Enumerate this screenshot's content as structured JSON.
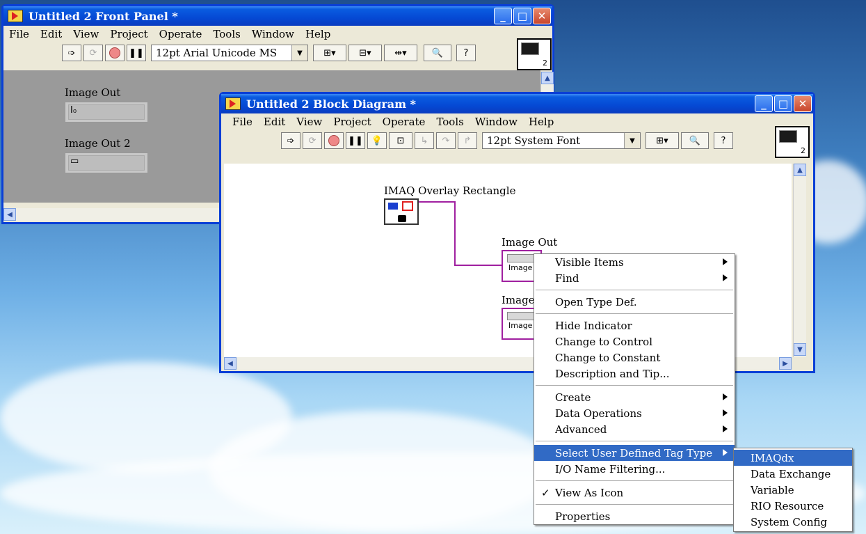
{
  "front_panel": {
    "title": "Untitled 2 Front Panel *",
    "menus": [
      "File",
      "Edit",
      "View",
      "Project",
      "Operate",
      "Tools",
      "Window",
      "Help"
    ],
    "font": "12pt Arial Unicode MS",
    "controls": [
      {
        "label": "Image Out",
        "value": "I₀"
      },
      {
        "label": "Image Out 2",
        "value": ""
      }
    ]
  },
  "block_diagram": {
    "title": "Untitled 2 Block Diagram *",
    "menus": [
      "File",
      "Edit",
      "View",
      "Project",
      "Operate",
      "Tools",
      "Window",
      "Help"
    ],
    "font": "12pt System Font",
    "node_label": "IMAQ Overlay Rectangle",
    "terminals": [
      {
        "label": "Image Out",
        "text": "Image"
      },
      {
        "label": "Image",
        "text": "Image"
      }
    ]
  },
  "icon_number": "2",
  "context_menu": {
    "items": [
      {
        "label": "Visible Items",
        "sub": true
      },
      {
        "label": "Find",
        "sub": true
      },
      {
        "sep": true
      },
      {
        "label": "Open Type Def."
      },
      {
        "sep": true
      },
      {
        "label": "Hide Indicator"
      },
      {
        "label": "Change to Control"
      },
      {
        "label": "Change to Constant"
      },
      {
        "label": "Description and Tip..."
      },
      {
        "sep": true
      },
      {
        "label": "Create",
        "sub": true
      },
      {
        "label": "Data Operations",
        "sub": true
      },
      {
        "label": "Advanced",
        "sub": true
      },
      {
        "sep": true
      },
      {
        "label": "Select User Defined Tag Type",
        "sub": true,
        "selected": true
      },
      {
        "label": "I/O Name Filtering..."
      },
      {
        "sep": true
      },
      {
        "label": "View As Icon",
        "checked": true
      },
      {
        "sep": true
      },
      {
        "label": "Properties"
      }
    ]
  },
  "submenu": {
    "items": [
      {
        "label": "IMAQdx",
        "selected": true
      },
      {
        "label": "Data Exchange"
      },
      {
        "label": "Variable"
      },
      {
        "label": "RIO Resource"
      },
      {
        "label": "System Config"
      }
    ]
  },
  "colors": {
    "title_bar": "#0549d4",
    "menu_highlight": "#316ac5",
    "wire": "#a020a0"
  }
}
